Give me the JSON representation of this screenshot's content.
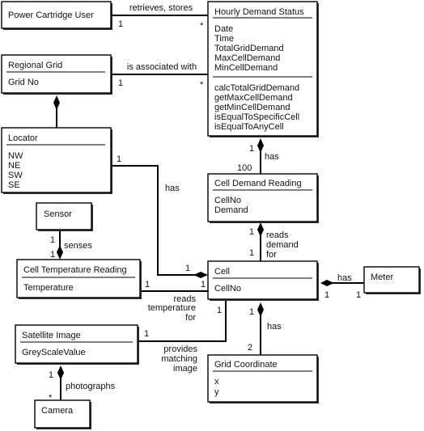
{
  "classes": {
    "power_cartridge_user": {
      "name": "Power Cartridge User"
    },
    "hourly_demand_status": {
      "name": "Hourly Demand Status",
      "attributes": [
        "Date",
        "Time",
        "TotalGridDemand",
        "MaxCellDemand",
        "MinCellDemand"
      ],
      "methods": [
        "calcTotalGridDemand",
        "getMaxCellDemand",
        "getMinCellDemand",
        "isEqualToSpecificCell",
        "isEqualToAnyCell"
      ]
    },
    "regional_grid": {
      "name": "Regional Grid",
      "attributes": [
        "Grid No"
      ]
    },
    "locator": {
      "name": "Locator",
      "attributes": [
        "NW",
        "NE",
        "SW",
        "SE"
      ]
    },
    "cell_demand_reading": {
      "name": "Cell Demand Reading",
      "attributes": [
        "CellNo",
        "Demand"
      ]
    },
    "sensor": {
      "name": "Sensor"
    },
    "cell_temperature_reading": {
      "name": "Cell Temperature Reading",
      "attributes": [
        "Temperature"
      ]
    },
    "cell": {
      "name": "Cell",
      "attributes": [
        "CellNo"
      ]
    },
    "meter": {
      "name": "Meter"
    },
    "satellite_image": {
      "name": "Satellite Image",
      "attributes": [
        "GreyScaleValue"
      ]
    },
    "grid_coordinate": {
      "name": "Grid Coordinate",
      "attributes": [
        "x",
        "y"
      ]
    },
    "camera": {
      "name": "Camera"
    }
  },
  "associations": {
    "user_hds": {
      "label": "retrieves, stores",
      "m1": "1",
      "m2": "*"
    },
    "grid_hds": {
      "label": "is associated with",
      "m1": "1",
      "m2": "*"
    },
    "grid_locator": {
      "type": "composition"
    },
    "hds_cdr": {
      "label": "has",
      "m1": "1",
      "m2": "100"
    },
    "locator_cell": {
      "label": "has",
      "m1": "1",
      "m2": "1"
    },
    "sensor_ctr": {
      "label": "senses",
      "m1": "1",
      "m2": "1"
    },
    "cdr_cell": {
      "label": [
        "reads",
        "demand",
        "for"
      ],
      "m1": "1",
      "m2": "1"
    },
    "ctr_cell": {
      "label": [
        "reads",
        "temperature",
        "for"
      ],
      "m1": "1",
      "m2": "1"
    },
    "cell_meter": {
      "label": "has",
      "m1": "1",
      "m2": "1"
    },
    "cell_satellite": {
      "label": [
        "provides",
        "matching",
        "image"
      ],
      "m1": "1",
      "m2": "1"
    },
    "cell_gridcoord": {
      "label": "has",
      "m1": "1",
      "m2": "2"
    },
    "satellite_camera": {
      "label": "photographs",
      "m1": "1",
      "m2": "*"
    }
  }
}
